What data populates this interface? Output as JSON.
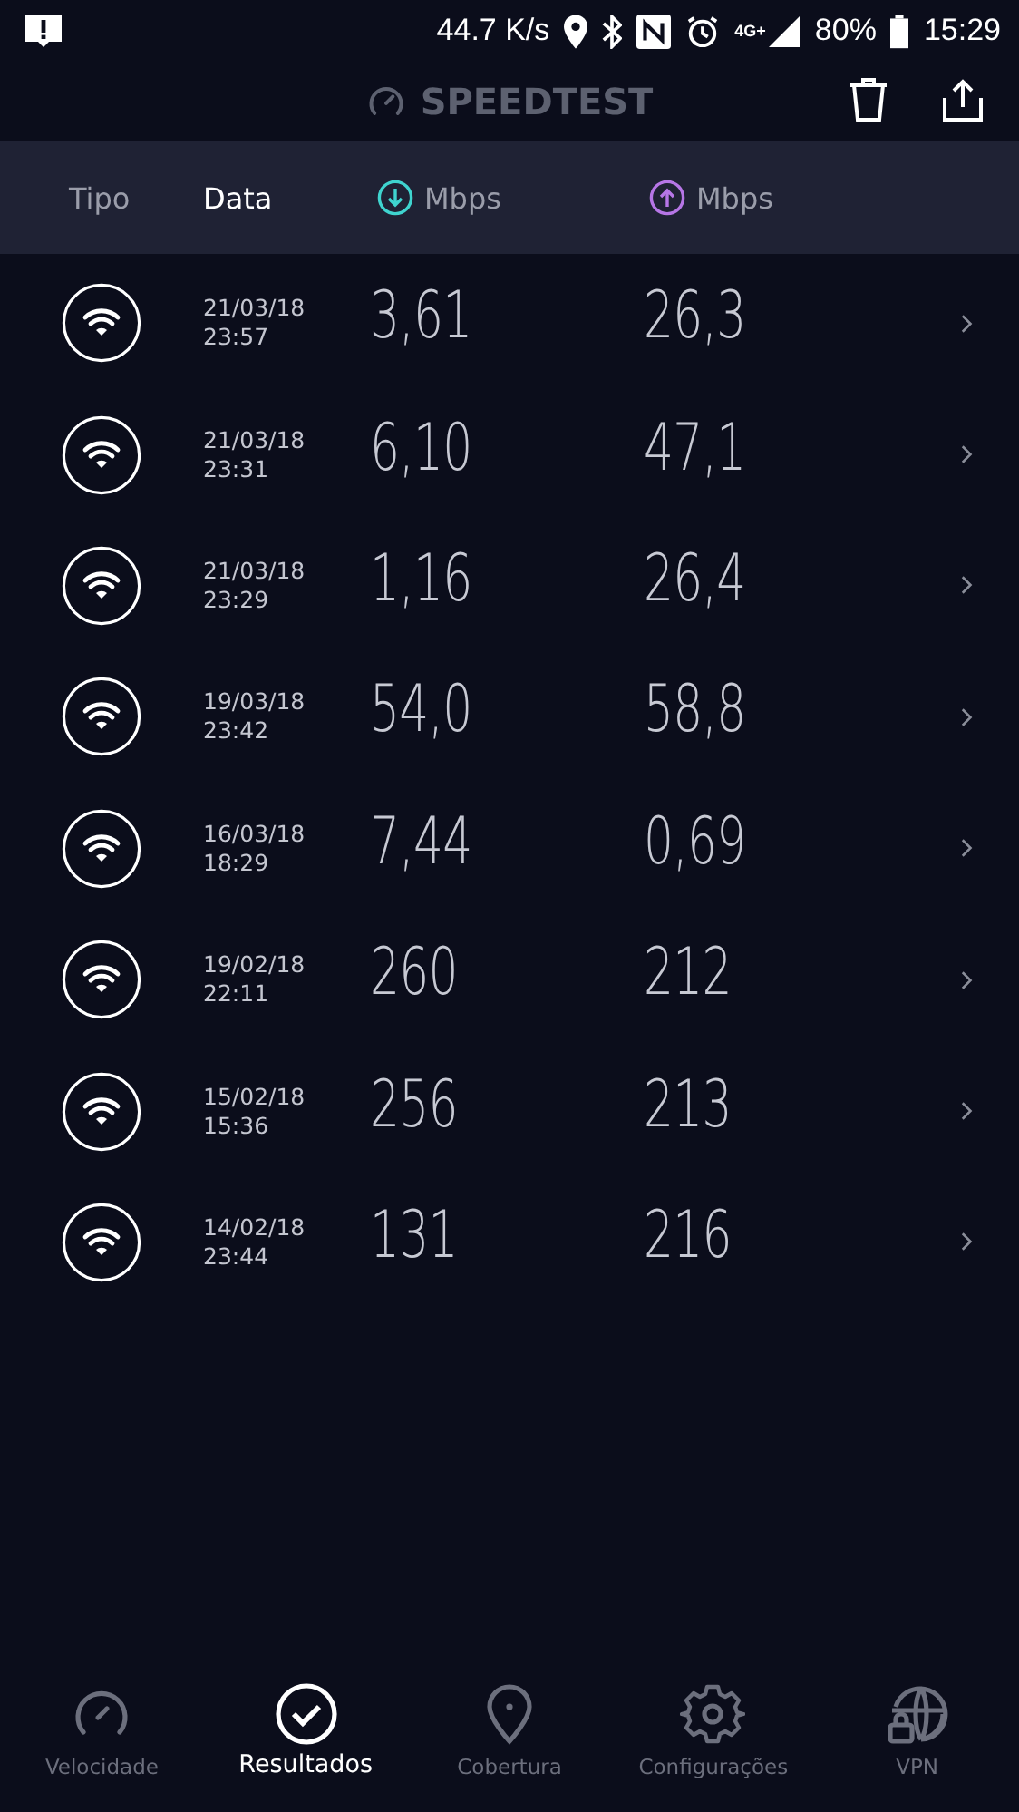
{
  "status_bar": {
    "speed": "44.7 K/s",
    "network": "4G+",
    "battery": "80%",
    "time": "15:29"
  },
  "app_bar": {
    "title": "SPEEDTEST"
  },
  "columns": [
    {
      "label": "Tipo",
      "kind": "text",
      "selected": false
    },
    {
      "label": "Data",
      "kind": "text",
      "selected": true
    },
    {
      "label": "Mbps",
      "kind": "download",
      "selected": false
    },
    {
      "label": "Mbps",
      "kind": "upload",
      "selected": false
    }
  ],
  "results": [
    {
      "date": "21/03/18",
      "time": "23:57",
      "download": "3,61",
      "upload": "26,3"
    },
    {
      "date": "21/03/18",
      "time": "23:31",
      "download": "6,10",
      "upload": "47,1"
    },
    {
      "date": "21/03/18",
      "time": "23:29",
      "download": "1,16",
      "upload": "26,4"
    },
    {
      "date": "19/03/18",
      "time": "23:42",
      "download": "54,0",
      "upload": "58,8"
    },
    {
      "date": "16/03/18",
      "time": "18:29",
      "download": "7,44",
      "upload": "0,69"
    },
    {
      "date": "19/02/18",
      "time": "22:11",
      "download": "260",
      "upload": "212"
    },
    {
      "date": "15/02/18",
      "time": "15:36",
      "download": "256",
      "upload": "213"
    },
    {
      "date": "14/02/18",
      "time": "23:44",
      "download": "131",
      "upload": "216"
    }
  ],
  "nav": [
    {
      "label": "Velocidade",
      "kind": "gauge",
      "selected": false
    },
    {
      "label": "Resultados",
      "kind": "check",
      "selected": true
    },
    {
      "label": "Cobertura",
      "kind": "pin",
      "selected": false
    },
    {
      "label": "Configurações",
      "kind": "gear",
      "selected": false
    },
    {
      "label": "VPN",
      "kind": "vpn",
      "selected": false
    }
  ]
}
